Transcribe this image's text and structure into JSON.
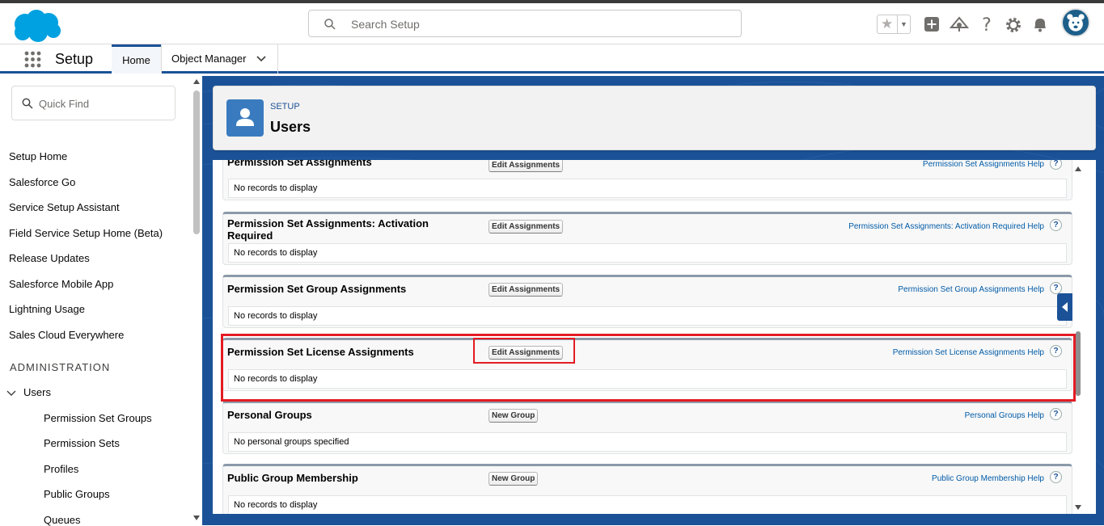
{
  "header": {
    "search_placeholder": "Search Setup",
    "icons": [
      "salesforce-cloud-logo",
      "favorites-star-icon",
      "add-icon",
      "trailhead-icon",
      "help-icon",
      "gear-icon",
      "bell-icon",
      "user-avatar"
    ]
  },
  "appnav": {
    "app_name": "Setup",
    "tabs": [
      {
        "label": "Home",
        "active": true
      },
      {
        "label": "Object Manager",
        "active": false
      }
    ]
  },
  "sidebar": {
    "quick_find_placeholder": "Quick Find",
    "items": [
      "Setup Home",
      "Salesforce Go",
      "Service Setup Assistant",
      "Field Service Setup Home (Beta)",
      "Release Updates",
      "Salesforce Mobile App",
      "Lightning Usage",
      "Sales Cloud Everywhere"
    ],
    "admin_header": "ADMINISTRATION",
    "users_label": "Users",
    "sub_items": [
      "Permission Set Groups",
      "Permission Sets",
      "Profiles",
      "Public Groups",
      "Queues"
    ]
  },
  "page": {
    "eyebrow": "SETUP",
    "title": "Users"
  },
  "sections": [
    {
      "title": "Permission Set Assignments",
      "button": "Edit Assignments",
      "help": "Permission Set Assignments Help",
      "body": "No records to display"
    },
    {
      "title": "Permission Set Assignments: Activation Required",
      "button": "Edit Assignments",
      "help": "Permission Set Assignments: Activation Required Help",
      "body": "No records to display"
    },
    {
      "title": "Permission Set Group Assignments",
      "button": "Edit Assignments",
      "help": "Permission Set Group Assignments Help",
      "body": "No records to display"
    },
    {
      "title": "Permission Set License Assignments",
      "button": "Edit Assignments",
      "help": "Permission Set License Assignments Help",
      "body": "No records to display"
    },
    {
      "title": "Personal Groups",
      "button": "New Group",
      "help": "Personal Groups Help",
      "body": "No personal groups specified"
    },
    {
      "title": "Public Group Membership",
      "button": "New Group",
      "help": "Public Group Membership Help",
      "body": "No records to display"
    }
  ],
  "colors": {
    "brand_blue": "#1b5297",
    "highlight_red": "#e31b23",
    "help_link": "#015ba7"
  }
}
